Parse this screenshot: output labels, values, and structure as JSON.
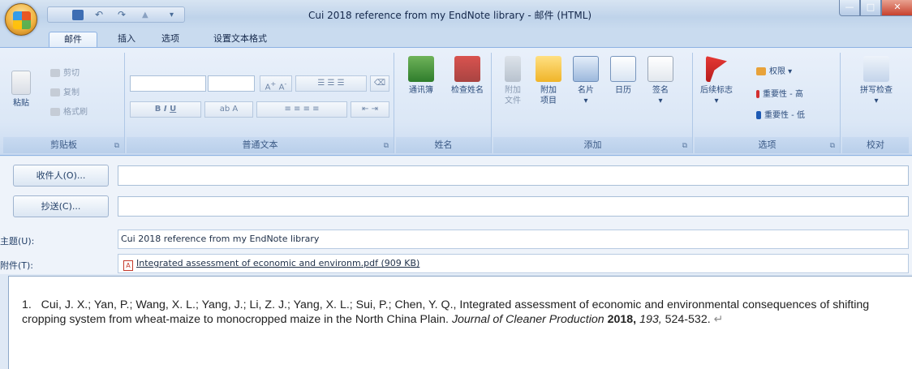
{
  "window": {
    "title": "Cui 2018 reference from my EndNote library - 邮件 (HTML)"
  },
  "tabs": [
    {
      "label": "邮件"
    },
    {
      "label": "插入"
    },
    {
      "label": "选项"
    },
    {
      "label": "设置文本格式"
    }
  ],
  "ribbon": {
    "clipboard": {
      "label": "剪贴板",
      "paste": "粘贴",
      "cut": "剪切",
      "copy": "复制",
      "format_painter": "格式刷"
    },
    "basic_text": {
      "label": "普通文本"
    },
    "names": {
      "label": "姓名",
      "address_book": "通讯簿",
      "check_names": "检查姓名"
    },
    "include": {
      "label": "添加",
      "attach_file_line1": "附加",
      "attach_file_line2": "文件",
      "attach_item_line1": "附加",
      "attach_item_line2": "项目",
      "business_card": "名片",
      "calendar": "日历",
      "signature": "签名"
    },
    "options": {
      "label": "选项",
      "follow_up": "后续标志",
      "permission": "权限",
      "high_importance": "重要性 - 高",
      "low_importance": "重要性 - 低"
    },
    "proofing": {
      "label": "校对",
      "spelling": "拼写检查"
    }
  },
  "message": {
    "to_button": "收件人(O)...",
    "cc_button": "抄送(C)...",
    "subject_label": "主题(U):",
    "subject_value": "Cui 2018 reference from my EndNote library",
    "attached_label": "附件(T):",
    "attachment_name": "Integrated assessment of economic and environm.pdf (909 KB)"
  },
  "body": {
    "ref_number": "1.",
    "authors": "Cui, J. X.; Yan, P.; Wang, X. L.; Yang, J.; Li, Z. J.; Yang, X. L.; Sui, P.; Chen, Y. Q., Integrated assessment of economic and environmental consequences of shifting cropping system from wheat-maize to monocropped maize in the North China Plain.",
    "journal": "Journal of Cleaner Production",
    "year": "2018,",
    "volume": "193,",
    "pages": "524-532.",
    "paragraph_mark": "↵"
  }
}
